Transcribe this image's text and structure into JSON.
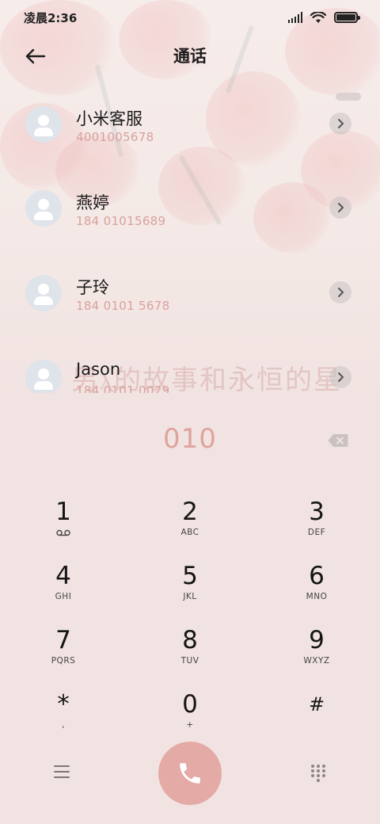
{
  "status_bar": {
    "time": "凌晨2:36"
  },
  "header": {
    "title": "通话",
    "back_icon": "arrow-left-icon"
  },
  "contacts": [
    {
      "name": "小米客服",
      "number": "4001005678"
    },
    {
      "name": "燕婷",
      "number": "184 01015689"
    },
    {
      "name": "子玲",
      "number": "184 0101 5678"
    },
    {
      "name": "Jason",
      "number": "184 0101 0029"
    }
  ],
  "dialer": {
    "input_value": "010",
    "keys": [
      {
        "digit": "1",
        "letters": ""
      },
      {
        "digit": "2",
        "letters": "ABC"
      },
      {
        "digit": "3",
        "letters": "DEF"
      },
      {
        "digit": "4",
        "letters": "GHI"
      },
      {
        "digit": "5",
        "letters": "JKL"
      },
      {
        "digit": "6",
        "letters": "MNO"
      },
      {
        "digit": "7",
        "letters": "PQRS"
      },
      {
        "digit": "8",
        "letters": "TUV"
      },
      {
        "digit": "9",
        "letters": "WXYZ"
      },
      {
        "digit": "*",
        "letters": ","
      },
      {
        "digit": "0",
        "letters": "+"
      },
      {
        "digit": "#",
        "letters": ""
      }
    ]
  },
  "colors": {
    "accent": "#e4aaa5",
    "number_text": "#d9a19c",
    "background": "#f1e3e1"
  }
}
